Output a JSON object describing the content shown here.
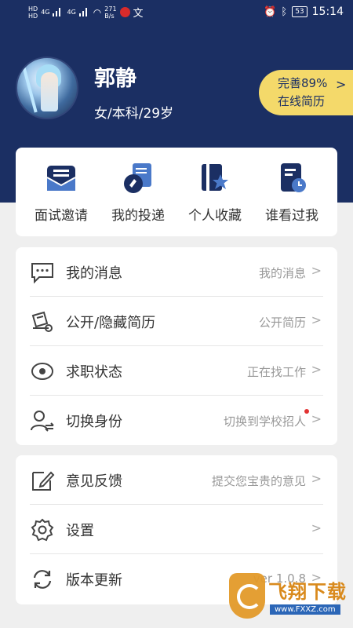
{
  "status_bar": {
    "sim1": "HD",
    "sim2": "HD",
    "net1": "4G",
    "net2": "4G",
    "speed_value": "271",
    "speed_unit": "B/s",
    "app_badge": "文",
    "battery": "53",
    "time": "15:14"
  },
  "profile": {
    "name": "郭静",
    "info": "女/本科/29岁",
    "resume_line1": "完善89%",
    "resume_line2": "在线简历",
    "resume_chevron": ">"
  },
  "quick_actions": [
    {
      "label": "面试邀请",
      "icon": "interview-invite-icon"
    },
    {
      "label": "我的投递",
      "icon": "my-delivery-icon"
    },
    {
      "label": "个人收藏",
      "icon": "favorites-icon"
    },
    {
      "label": "谁看过我",
      "icon": "who-viewed-me-icon"
    }
  ],
  "menu_group1": [
    {
      "label": "我的消息",
      "value": "我的消息",
      "icon": "message-icon"
    },
    {
      "label": "公开/隐藏简历",
      "value": "公开简历",
      "icon": "resume-visibility-icon"
    },
    {
      "label": "求职状态",
      "value": "正在找工作",
      "icon": "job-status-icon"
    },
    {
      "label": "切换身份",
      "value": "切换到学校招人",
      "icon": "switch-identity-icon"
    }
  ],
  "menu_group2": [
    {
      "label": "意见反馈",
      "value": "提交您宝贵的意见",
      "icon": "feedback-icon"
    },
    {
      "label": "设置",
      "value": "",
      "icon": "settings-icon"
    },
    {
      "label": "版本更新",
      "value": "ver 1.0.8",
      "icon": "update-icon"
    }
  ],
  "chevron": ">",
  "watermark": {
    "text": "飞翔下载",
    "url": "www.FXXZ.com"
  },
  "colors": {
    "header": "#1b2f63",
    "accent": "#f4d96a",
    "icon_navy": "#1b2f63",
    "icon_blue": "#4a79c9"
  }
}
